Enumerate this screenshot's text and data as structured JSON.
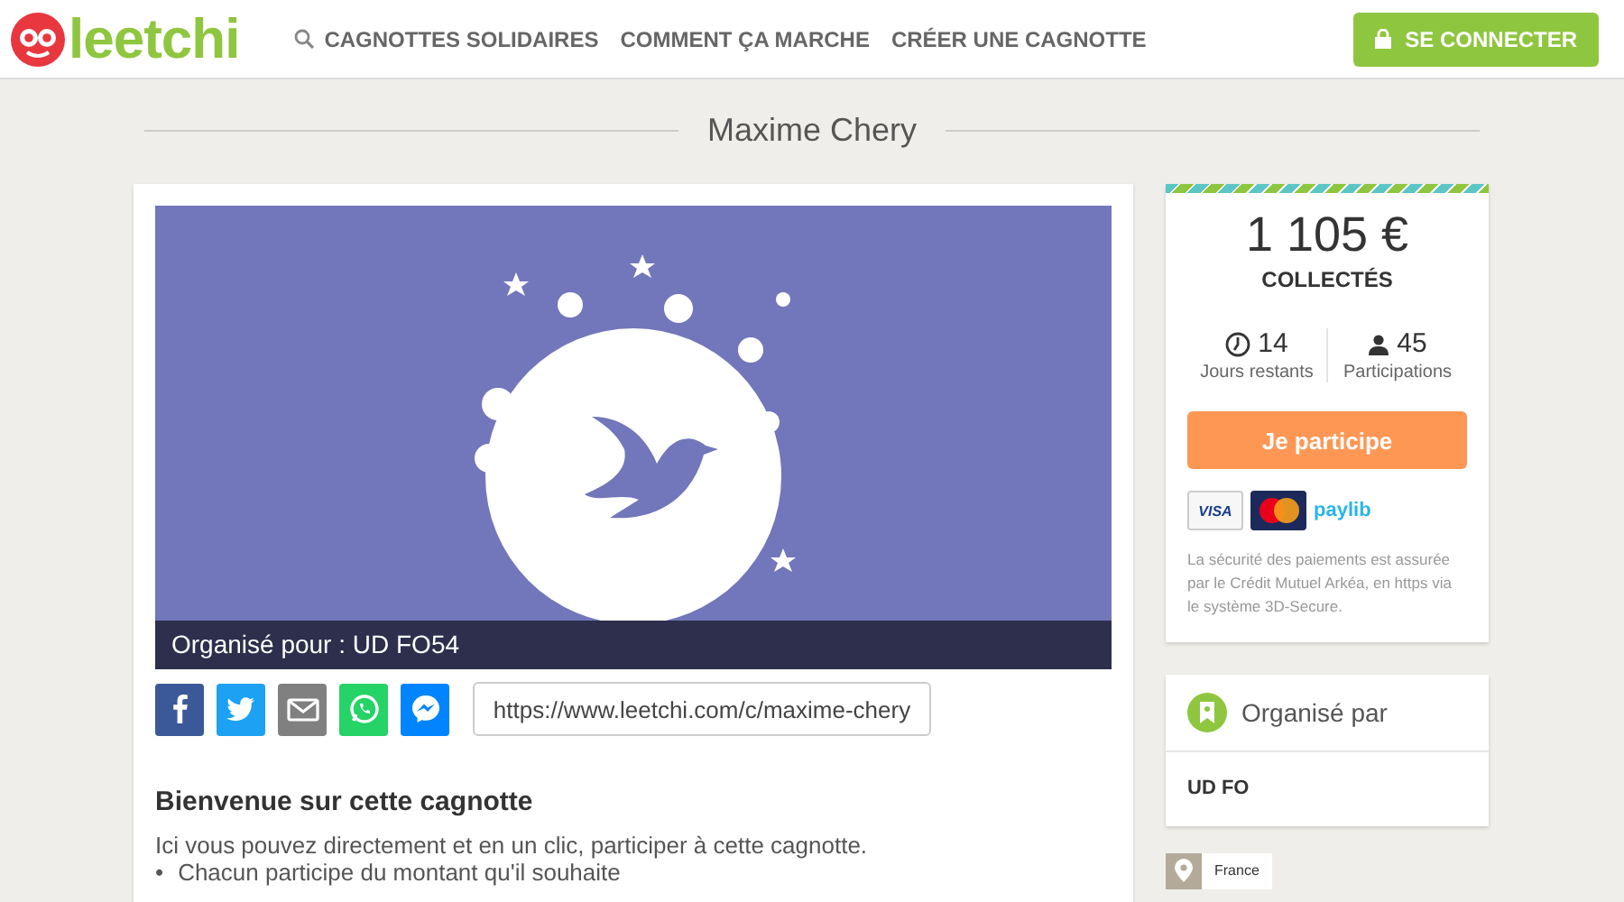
{
  "header": {
    "logo": "leetchi",
    "nav": [
      {
        "label": "CAGNOTTES SOLIDAIRES",
        "kind": "search"
      },
      {
        "label": "COMMENT ÇA MARCHE",
        "kind": "plain"
      },
      {
        "label": "CRÉER UNE CAGNOTTE",
        "kind": "plain"
      }
    ],
    "login": "SE CONNECTER"
  },
  "page_title": "Maxime Chery",
  "campaign": {
    "cover_caption": "Organisé pour : UD FO54",
    "share": [
      {
        "kind": "facebook"
      },
      {
        "kind": "twitter"
      },
      {
        "kind": "email"
      },
      {
        "kind": "whatsapp"
      },
      {
        "kind": "messenger"
      }
    ],
    "url": "https://www.leetchi.com/c/maxime-chery",
    "heading": "Bienvenue sur cette cagnotte",
    "intro": "Ici vous pouvez directement et en un clic, participer à cette cagnotte.",
    "bullets": [
      {
        "marker": "•",
        "text": "Chacun participe du montant qu'il souhaite"
      }
    ]
  },
  "sidebar": {
    "amount": "1 105 €",
    "amount_label": "COLLECTÉS",
    "stats": [
      {
        "kind": "days",
        "value": "14",
        "label": "Jours restants"
      },
      {
        "kind": "participants",
        "value": "45",
        "label": "Participations"
      }
    ],
    "cta": "Je participe",
    "payments": [
      {
        "kind": "visa",
        "text": "VISA"
      },
      {
        "kind": "mastercard"
      },
      {
        "kind": "paylib",
        "text": "paylib"
      }
    ],
    "security_note": "La sécurité des paiements est assurée par le Crédit Mutuel Arkéa, en https via le système 3D-Secure.",
    "organizer_title": "Organisé par",
    "organizer_name": "UD FO",
    "location": "France"
  }
}
